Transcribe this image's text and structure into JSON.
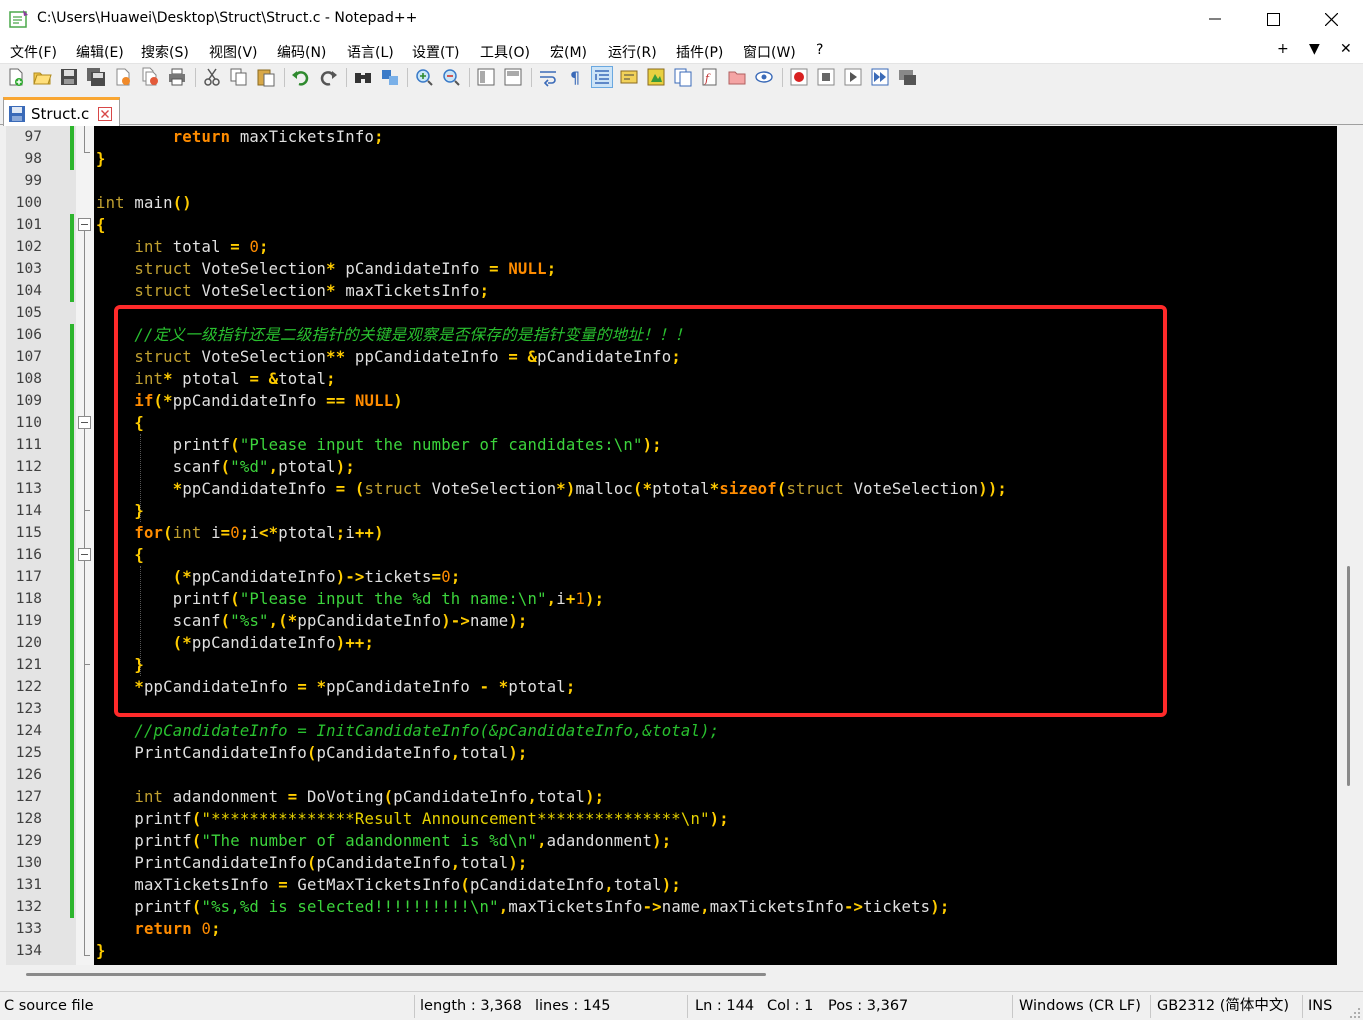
{
  "window": {
    "title": "C:\\Users\\Huawei\\Desktop\\Struct\\Struct.c - Notepad++",
    "minimize_glyph": "—",
    "maximize_glyph": "☐",
    "close_glyph": "✕"
  },
  "menu": {
    "items": [
      "文件(F)",
      "编辑(E)",
      "搜索(S)",
      "视图(V)",
      "编码(N)",
      "语言(L)",
      "设置(T)",
      "工具(O)",
      "宏(M)",
      "运行(R)",
      "插件(P)",
      "窗口(W)",
      "?"
    ],
    "right": [
      "+",
      "▼",
      "✕"
    ]
  },
  "toolbar": {
    "icons": [
      "new-file-icon",
      "open-file-icon",
      "save-icon",
      "save-all-icon",
      "close-icon",
      "close-all-icon",
      "print-icon",
      "cut-icon",
      "copy-icon",
      "paste-icon",
      "undo-icon",
      "redo-icon",
      "find-icon",
      "replace-icon",
      "zoom-in-icon",
      "zoom-out-icon",
      "sync-vertical-icon",
      "sync-horizontal-icon",
      "word-wrap-icon",
      "show-all-chars-icon",
      "indent-guide-icon",
      "udl-icon",
      "doc-map-icon",
      "doc-list-icon",
      "function-list-icon",
      "folder-workspace-icon",
      "monitor-icon",
      "record-macro-icon",
      "stop-macro-icon",
      "play-macro-icon",
      "run-macro-multiple-icon",
      "save-macro-icon"
    ]
  },
  "tabs": [
    {
      "label": "Struct.c",
      "active": true
    }
  ],
  "editor": {
    "line_numbers": [
      "97",
      "98",
      "99",
      "100",
      "101",
      "102",
      "103",
      "104",
      "105",
      "106",
      "107",
      "108",
      "109",
      "110",
      "111",
      "112",
      "113",
      "114",
      "115",
      "116",
      "117",
      "118",
      "119",
      "120",
      "121",
      "122",
      "123",
      "124",
      "125",
      "126",
      "127",
      "128",
      "129",
      "130",
      "131",
      "132",
      "133",
      "134"
    ],
    "lines": [
      [
        [
          "    ",
          "tx"
        ],
        [
          "    ",
          "tx"
        ],
        [
          "return",
          "kw"
        ],
        [
          " maxTicketsInfo",
          "tx"
        ],
        [
          ";",
          "op"
        ]
      ],
      [
        [
          "}",
          "op"
        ]
      ],
      [],
      [
        [
          "int",
          "ty"
        ],
        [
          " main",
          "tx"
        ],
        [
          "()",
          "op"
        ]
      ],
      [
        [
          "{",
          "op"
        ]
      ],
      [
        [
          "    ",
          "tx"
        ],
        [
          "int",
          "ty"
        ],
        [
          " total ",
          "tx"
        ],
        [
          "=",
          "op"
        ],
        [
          " ",
          "tx"
        ],
        [
          "0",
          "num"
        ],
        [
          ";",
          "op"
        ]
      ],
      [
        [
          "    ",
          "tx"
        ],
        [
          "struct",
          "ty"
        ],
        [
          " VoteSelection",
          "tx"
        ],
        [
          "*",
          "op"
        ],
        [
          " pCandidateInfo ",
          "tx"
        ],
        [
          "=",
          "op"
        ],
        [
          " ",
          "tx"
        ],
        [
          "NULL",
          "nul"
        ],
        [
          ";",
          "op"
        ]
      ],
      [
        [
          "    ",
          "tx"
        ],
        [
          "struct",
          "ty"
        ],
        [
          " VoteSelection",
          "tx"
        ],
        [
          "*",
          "op"
        ],
        [
          " maxTicketsInfo",
          "tx"
        ],
        [
          ";",
          "op"
        ]
      ],
      [],
      [
        [
          "    ",
          "tx"
        ],
        [
          "//定义一级指针还是二级指针的关键是观察是否保存的是指针变量的地址！！！",
          "cm"
        ]
      ],
      [
        [
          "    ",
          "tx"
        ],
        [
          "struct",
          "ty"
        ],
        [
          " VoteSelection",
          "tx"
        ],
        [
          "**",
          "op"
        ],
        [
          " ppCandidateInfo ",
          "tx"
        ],
        [
          "=",
          "op"
        ],
        [
          " ",
          "tx"
        ],
        [
          "&",
          "op"
        ],
        [
          "pCandidateInfo",
          "tx"
        ],
        [
          ";",
          "op"
        ]
      ],
      [
        [
          "    ",
          "tx"
        ],
        [
          "int",
          "ty"
        ],
        [
          "*",
          "op"
        ],
        [
          " ptotal ",
          "tx"
        ],
        [
          "=",
          "op"
        ],
        [
          " ",
          "tx"
        ],
        [
          "&",
          "op"
        ],
        [
          "total",
          "tx"
        ],
        [
          ";",
          "op"
        ]
      ],
      [
        [
          "    ",
          "tx"
        ],
        [
          "if",
          "kw"
        ],
        [
          "(*",
          "op"
        ],
        [
          "ppCandidateInfo ",
          "tx"
        ],
        [
          "==",
          "op"
        ],
        [
          " ",
          "tx"
        ],
        [
          "NULL",
          "nul"
        ],
        [
          ")",
          "op"
        ]
      ],
      [
        [
          "    ",
          "tx"
        ],
        [
          "{",
          "op"
        ]
      ],
      [
        [
          "        ",
          "tx"
        ],
        [
          "printf",
          "tx"
        ],
        [
          "(",
          "op"
        ],
        [
          "\"Please input the number of candidates:\\n\"",
          "strg"
        ],
        [
          ");",
          "op"
        ]
      ],
      [
        [
          "        ",
          "tx"
        ],
        [
          "scanf",
          "tx"
        ],
        [
          "(",
          "op"
        ],
        [
          "\"%d\"",
          "strg"
        ],
        [
          ",",
          "op"
        ],
        [
          "ptotal",
          "tx"
        ],
        [
          ");",
          "op"
        ]
      ],
      [
        [
          "        ",
          "tx"
        ],
        [
          "*",
          "op"
        ],
        [
          "ppCandidateInfo ",
          "tx"
        ],
        [
          "=",
          "op"
        ],
        [
          " ",
          "tx"
        ],
        [
          "(",
          "op"
        ],
        [
          "struct",
          "ty"
        ],
        [
          " VoteSelection",
          "tx"
        ],
        [
          "*)",
          "op"
        ],
        [
          "malloc",
          "tx"
        ],
        [
          "(*",
          "op"
        ],
        [
          "ptotal",
          "tx"
        ],
        [
          "*",
          "op"
        ],
        [
          "sizeof",
          "kw"
        ],
        [
          "(",
          "op"
        ],
        [
          "struct",
          "ty"
        ],
        [
          " VoteSelection",
          "tx"
        ],
        [
          "));",
          "op"
        ]
      ],
      [
        [
          "    ",
          "tx"
        ],
        [
          "}",
          "op"
        ]
      ],
      [
        [
          "    ",
          "tx"
        ],
        [
          "for",
          "kw"
        ],
        [
          "(",
          "op"
        ],
        [
          "int",
          "ty"
        ],
        [
          " i",
          "tx"
        ],
        [
          "=",
          "op"
        ],
        [
          "0",
          "num"
        ],
        [
          ";",
          "op"
        ],
        [
          "i",
          "tx"
        ],
        [
          "<*",
          "op"
        ],
        [
          "ptotal",
          "tx"
        ],
        [
          ";",
          "op"
        ],
        [
          "i",
          "tx"
        ],
        [
          "++)",
          "op"
        ]
      ],
      [
        [
          "    ",
          "tx"
        ],
        [
          "{",
          "op"
        ]
      ],
      [
        [
          "        ",
          "tx"
        ],
        [
          "(*",
          "op"
        ],
        [
          "ppCandidateInfo",
          "tx"
        ],
        [
          ")->",
          "op"
        ],
        [
          "tickets",
          "tx"
        ],
        [
          "=",
          "op"
        ],
        [
          "0",
          "num"
        ],
        [
          ";",
          "op"
        ]
      ],
      [
        [
          "        ",
          "tx"
        ],
        [
          "printf",
          "tx"
        ],
        [
          "(",
          "op"
        ],
        [
          "\"Please input the %d th name:\\n\"",
          "strg"
        ],
        [
          ",",
          "op"
        ],
        [
          "i",
          "tx"
        ],
        [
          "+",
          "op"
        ],
        [
          "1",
          "num"
        ],
        [
          ");",
          "op"
        ]
      ],
      [
        [
          "        ",
          "tx"
        ],
        [
          "scanf",
          "tx"
        ],
        [
          "(",
          "op"
        ],
        [
          "\"%s\"",
          "strg"
        ],
        [
          ",(*",
          "op"
        ],
        [
          "ppCandidateInfo",
          "tx"
        ],
        [
          ")->",
          "op"
        ],
        [
          "name",
          "tx"
        ],
        [
          ");",
          "op"
        ]
      ],
      [
        [
          "        ",
          "tx"
        ],
        [
          "(*",
          "op"
        ],
        [
          "ppCandidateInfo",
          "tx"
        ],
        [
          ")++;",
          "op"
        ]
      ],
      [
        [
          "    ",
          "tx"
        ],
        [
          "}",
          "op"
        ]
      ],
      [
        [
          "    ",
          "tx"
        ],
        [
          "*",
          "op"
        ],
        [
          "ppCandidateInfo ",
          "tx"
        ],
        [
          "=",
          "op"
        ],
        [
          " ",
          "tx"
        ],
        [
          "*",
          "op"
        ],
        [
          "ppCandidateInfo ",
          "tx"
        ],
        [
          "-",
          "op"
        ],
        [
          " ",
          "tx"
        ],
        [
          "*",
          "op"
        ],
        [
          "ptotal",
          "tx"
        ],
        [
          ";",
          "op"
        ]
      ],
      [],
      [
        [
          "    ",
          "tx"
        ],
        [
          "//pCandidateInfo = InitCandidateInfo(&pCandidateInfo,&total);",
          "cm"
        ]
      ],
      [
        [
          "    ",
          "tx"
        ],
        [
          "PrintCandidateInfo",
          "tx"
        ],
        [
          "(",
          "op"
        ],
        [
          "pCandidateInfo",
          "tx"
        ],
        [
          ",",
          "op"
        ],
        [
          "total",
          "tx"
        ],
        [
          ");",
          "op"
        ]
      ],
      [],
      [
        [
          "    ",
          "tx"
        ],
        [
          "int",
          "ty"
        ],
        [
          " adandonment ",
          "tx"
        ],
        [
          "=",
          "op"
        ],
        [
          " DoVoting",
          "tx"
        ],
        [
          "(",
          "op"
        ],
        [
          "pCandidateInfo",
          "tx"
        ],
        [
          ",",
          "op"
        ],
        [
          "total",
          "tx"
        ],
        [
          ");",
          "op"
        ]
      ],
      [
        [
          "    ",
          "tx"
        ],
        [
          "printf",
          "tx"
        ],
        [
          "(",
          "op"
        ],
        [
          "\"***************Result Announcement***************\\n\"",
          "str"
        ],
        [
          ");",
          "op"
        ]
      ],
      [
        [
          "    ",
          "tx"
        ],
        [
          "printf",
          "tx"
        ],
        [
          "(",
          "op"
        ],
        [
          "\"The number of adandonment is %d\\n\"",
          "strg"
        ],
        [
          ",",
          "op"
        ],
        [
          "adandonment",
          "tx"
        ],
        [
          ");",
          "op"
        ]
      ],
      [
        [
          "    ",
          "tx"
        ],
        [
          "PrintCandidateInfo",
          "tx"
        ],
        [
          "(",
          "op"
        ],
        [
          "pCandidateInfo",
          "tx"
        ],
        [
          ",",
          "op"
        ],
        [
          "total",
          "tx"
        ],
        [
          ");",
          "op"
        ]
      ],
      [
        [
          "    ",
          "tx"
        ],
        [
          "maxTicketsInfo ",
          "tx"
        ],
        [
          "=",
          "op"
        ],
        [
          " GetMaxTicketsInfo",
          "tx"
        ],
        [
          "(",
          "op"
        ],
        [
          "pCandidateInfo",
          "tx"
        ],
        [
          ",",
          "op"
        ],
        [
          "total",
          "tx"
        ],
        [
          ");",
          "op"
        ]
      ],
      [
        [
          "    ",
          "tx"
        ],
        [
          "printf",
          "tx"
        ],
        [
          "(",
          "op"
        ],
        [
          "\"%s,%d is selected!!!!!!!!!!\\n\"",
          "strg"
        ],
        [
          ",",
          "op"
        ],
        [
          "maxTicketsInfo",
          "tx"
        ],
        [
          "->",
          "op"
        ],
        [
          "name",
          "tx"
        ],
        [
          ",",
          "op"
        ],
        [
          "maxTicketsInfo",
          "tx"
        ],
        [
          "->",
          "op"
        ],
        [
          "tickets",
          "tx"
        ],
        [
          ");",
          "op"
        ]
      ],
      [
        [
          "    ",
          "tx"
        ],
        [
          "return",
          "kw"
        ],
        [
          " ",
          "tx"
        ],
        [
          "0",
          "num"
        ],
        [
          ";",
          "op"
        ]
      ],
      [
        [
          "}",
          "op"
        ]
      ]
    ]
  },
  "status": {
    "file_type": "C source file",
    "length": "length : 3,368",
    "lines": "lines : 145",
    "ln": "Ln : 144",
    "col": "Col : 1",
    "pos": "Pos : 3,367",
    "eol": "Windows (CR LF)",
    "encoding": "GB2312 (简体中文)",
    "mode": "INS"
  },
  "colors": {
    "editor_bg": "#000000",
    "keyword": "#ff8c00",
    "type": "#c0a030",
    "string": "#3cd43c",
    "comment": "#29c02f",
    "highlight_box": "#ff2a2a",
    "tab_accent": "#f9a632"
  }
}
